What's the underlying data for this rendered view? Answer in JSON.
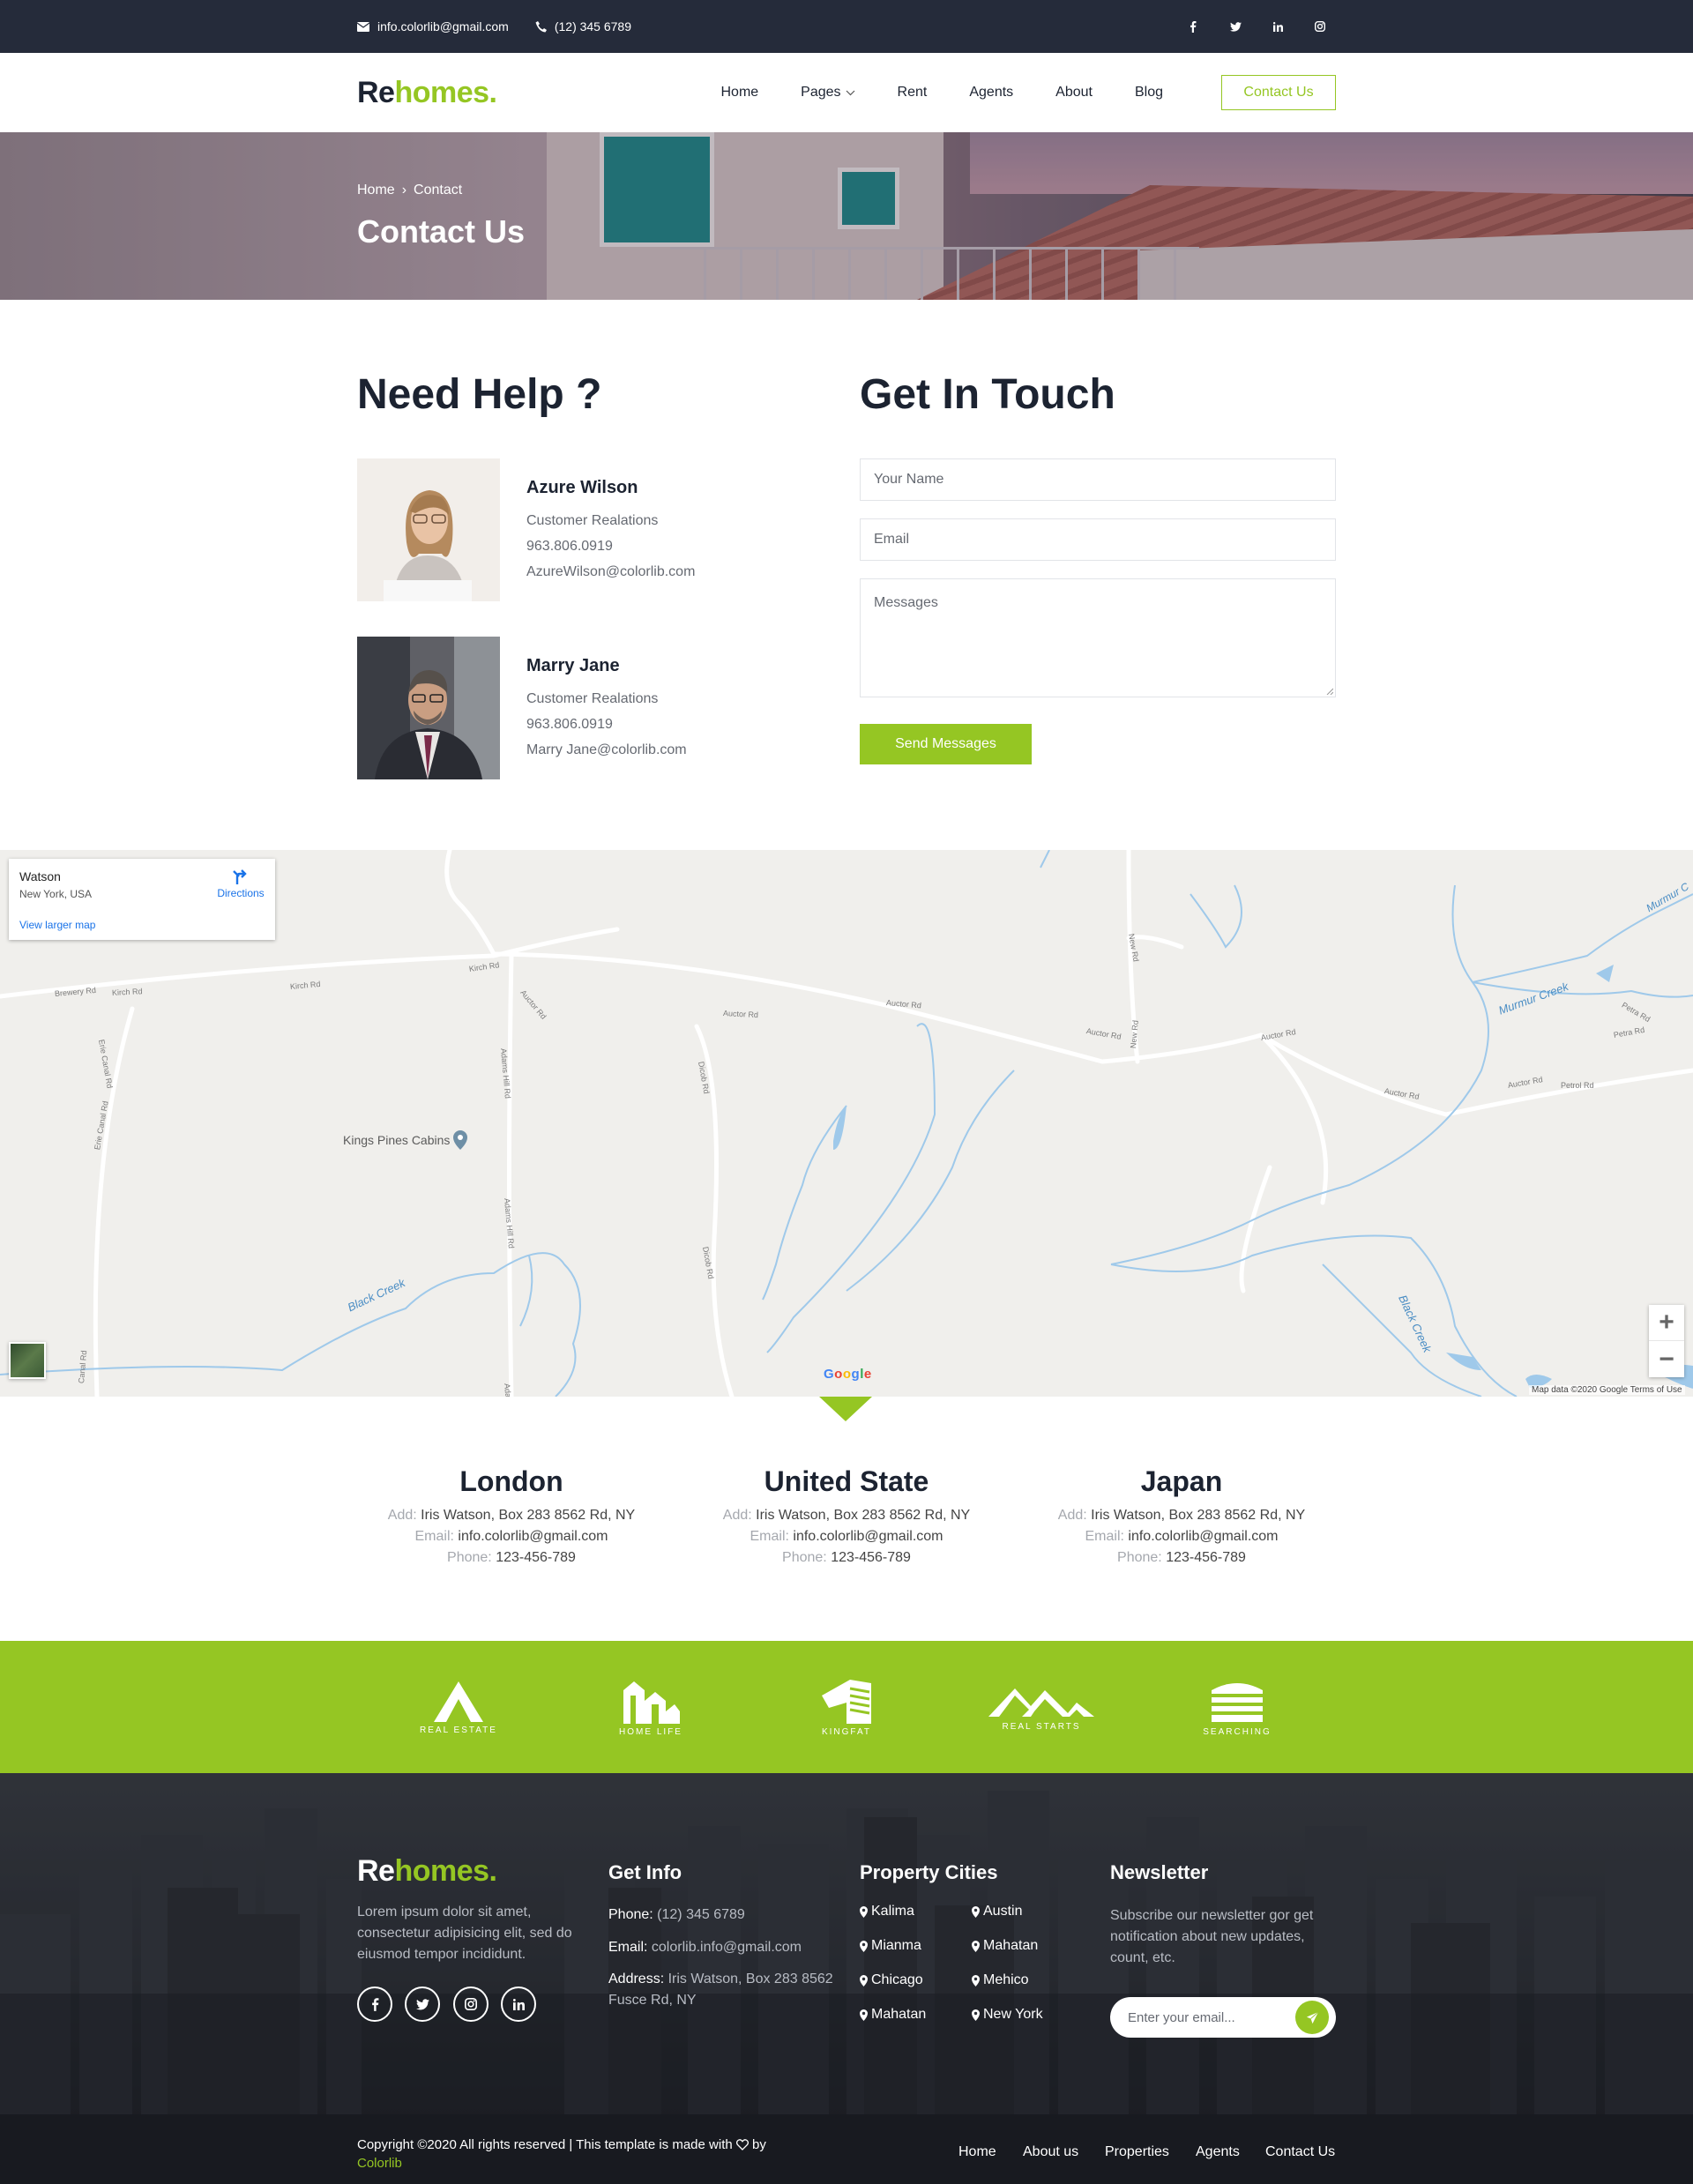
{
  "topbar": {
    "email": "info.colorlib@gmail.com",
    "phone": "(12) 345 6789",
    "social_icons": [
      "facebook-icon",
      "twitter-icon",
      "linkedin-icon",
      "instagram-icon"
    ]
  },
  "header": {
    "logo_re": "Re",
    "logo_homes": "homes.",
    "nav": [
      "Home",
      "Pages",
      "Rent",
      "Agents",
      "About",
      "Blog"
    ],
    "cta": "Contact Us"
  },
  "hero": {
    "breadcrumb_home": "Home",
    "breadcrumb_sep": "›",
    "breadcrumb_current": "Contact",
    "title": "Contact Us"
  },
  "help": {
    "title": "Need Help ?",
    "people": [
      {
        "name": "Azure Wilson",
        "role": "Customer Realations",
        "phone": "963.806.0919",
        "email": "AzureWilson@colorlib.com"
      },
      {
        "name": "Marry Jane",
        "role": "Customer Realations",
        "phone": "963.806.0919",
        "email": "Marry Jane@colorlib.com"
      }
    ]
  },
  "contact_form": {
    "title": "Get In Touch",
    "name_placeholder": "Your Name",
    "email_placeholder": "Email",
    "message_placeholder": "Messages",
    "submit": "Send Messages"
  },
  "map": {
    "place_title": "Watson",
    "place_sub": "New York, USA",
    "larger_map": "View larger map",
    "directions": "Directions",
    "poi": "Kings Pines Cabins",
    "google": "Google",
    "attribution": "Map data ©2020 Google  Terms of Use",
    "zoom_in": "+",
    "zoom_out": "−",
    "road_labels": [
      "Brewery Rd",
      "Kirch Rd",
      "Kirch Rd",
      "Kirch Rd",
      "Auctor Rd",
      "Auctor Rd",
      "Auctor Rd",
      "Auctor Rd",
      "Auctor Rd",
      "Auctor Rd",
      "Auctor Rd",
      "Petrol Rd",
      "Adams Hill Rd",
      "Adams Hill Rd",
      "Adams Hill Rd",
      "Dicob Rd",
      "Dicob Rd",
      "Erie Canal Rd",
      "Erie Canal Rd",
      "Canal Rd",
      "New Rd",
      "New Rd",
      "Petra Rd",
      "Petra Rd"
    ],
    "water_labels": [
      "Black Creek",
      "Black Creek",
      "Murmur Creek",
      "Murmur C"
    ],
    "colors": {
      "land": "#f0efec",
      "road": "#ffffff",
      "water": "#9fc9ea"
    }
  },
  "offices": [
    {
      "city": "London",
      "add_label": "Add:",
      "add": "Iris Watson, Box 283 8562 Rd, NY",
      "email_label": "Email:",
      "email": "info.colorlib@gmail.com",
      "phone_label": "Phone:",
      "phone": "123-456-789"
    },
    {
      "city": "United State",
      "add_label": "Add:",
      "add": "Iris Watson, Box 283 8562 Rd, NY",
      "email_label": "Email:",
      "email": "info.colorlib@gmail.com",
      "phone_label": "Phone:",
      "phone": "123-456-789"
    },
    {
      "city": "Japan",
      "add_label": "Add:",
      "add": "Iris Watson, Box 283 8562 Rd, NY",
      "email_label": "Email:",
      "email": "info.colorlib@gmail.com",
      "phone_label": "Phone:",
      "phone": "123-456-789"
    }
  ],
  "brands": [
    "REAL ESTATE",
    "HOME LIFE",
    "KINGFAT",
    "REAL STARTS",
    "SEARCHING"
  ],
  "footer": {
    "about": "Lorem ipsum dolor sit amet, consectetur adipisicing elit, sed do eiusmod tempor incididunt.",
    "social_icons": [
      "facebook-icon",
      "twitter-icon",
      "instagram-icon",
      "linkedin-icon"
    ],
    "info_title": "Get Info",
    "phone_label": "Phone:",
    "phone": "(12) 345 6789",
    "email_label": "Email:",
    "email": "colorlib.info@gmail.com",
    "address_label": "Address:",
    "address": "Iris Watson, Box 283 8562 Fusce Rd, NY",
    "cities_title": "Property Cities",
    "cities_col1": [
      "Kalima",
      "Mianma",
      "Chicago",
      "Mahatan"
    ],
    "cities_col2": [
      "Austin",
      "Mahatan",
      "Mehico",
      "New York"
    ],
    "news_title": "Newsletter",
    "news_text": "Subscribe our newsletter gor get notification about new updates, count, etc.",
    "news_placeholder": "Enter your email...",
    "copyright": "Copyright ©2020 All rights reserved | This template is made with",
    "copyright_by": "by",
    "copyright_link": "Colorlib",
    "bottom_nav": [
      "Home",
      "About us",
      "Properties",
      "Agents",
      "Contact Us"
    ]
  },
  "colors": {
    "accent": "#95c623",
    "dark": "#252b3a",
    "text": "#1c2331",
    "muted": "#666a72"
  }
}
